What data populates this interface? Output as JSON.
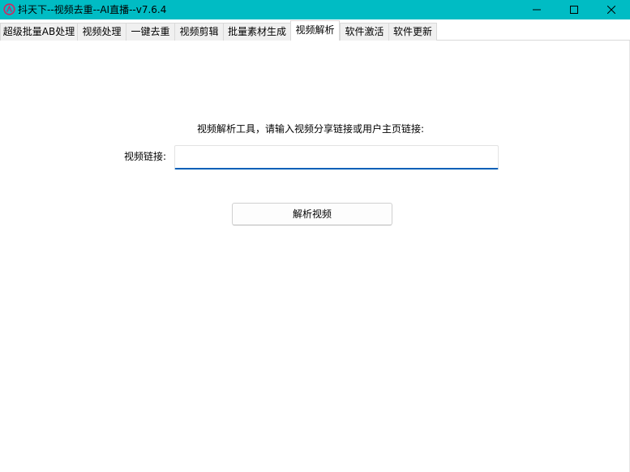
{
  "window": {
    "title": "抖天下--视频去重--AI直播--v7.6.4",
    "accent_color": "#00bcc4",
    "icon": "app-logo-icon",
    "controls": [
      "minimize-icon",
      "maximize-icon",
      "close-icon"
    ]
  },
  "tabs": [
    {
      "label": "超级批量AB处理",
      "active": false
    },
    {
      "label": "视频处理",
      "active": false
    },
    {
      "label": "一键去重",
      "active": false
    },
    {
      "label": "视频剪辑",
      "active": false
    },
    {
      "label": "批量素材生成",
      "active": false
    },
    {
      "label": "视频解析",
      "active": true
    },
    {
      "label": "软件激活",
      "active": false
    },
    {
      "label": "软件更新",
      "active": false
    }
  ],
  "main": {
    "instruction": "视频解析工具，请输入视频分享链接或用户主页链接:",
    "url_label": "视频链接:",
    "url_value": "",
    "url_placeholder": "",
    "parse_button_label": "解析视频",
    "input_focus_color": "#005fb8"
  }
}
